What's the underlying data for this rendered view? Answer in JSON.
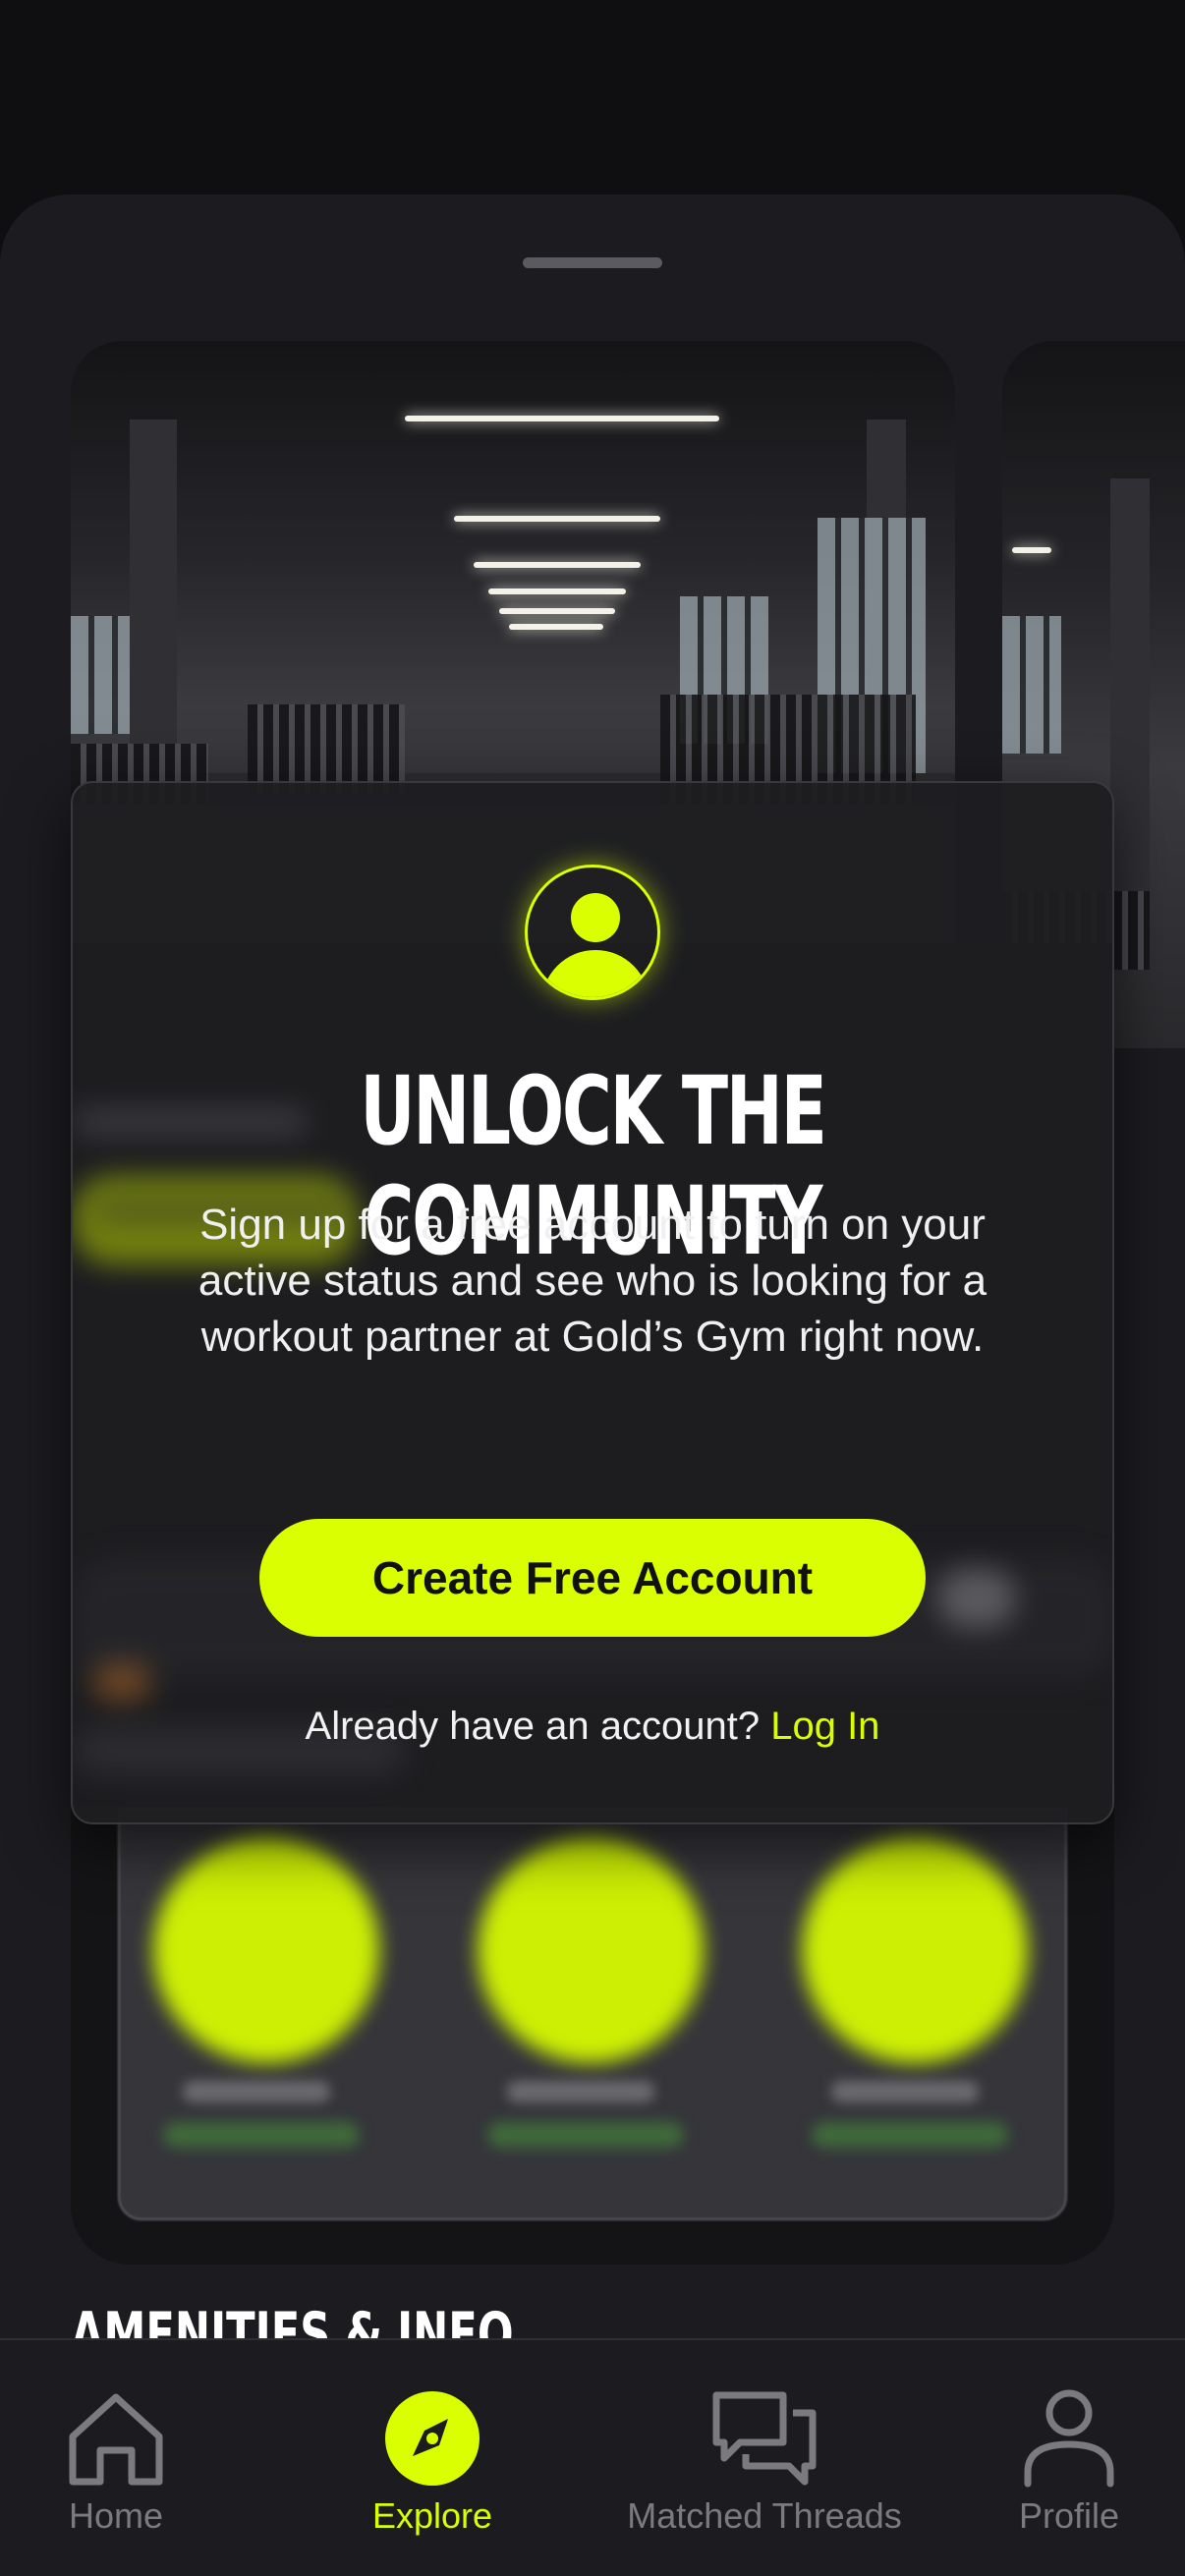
{
  "modal": {
    "title": "UNLOCK THE COMMUNITY",
    "body": "Sign up for a free account to turn on your active status and see who is looking for a workout partner at Gold’s Gym right now.",
    "cta_label": "Create Free Account",
    "login_prompt": "Already have an account?",
    "login_link": "Log In",
    "icon": "user-icon"
  },
  "section_heading": "AMENITIES & INFO",
  "tabs": [
    {
      "label": "Home",
      "icon": "home-icon",
      "active": false
    },
    {
      "label": "Explore",
      "icon": "compass-icon",
      "active": true
    },
    {
      "label": "Matched Threads",
      "icon": "chat-bubbles-icon",
      "active": false
    },
    {
      "label": "Profile",
      "icon": "person-icon",
      "active": false
    }
  ],
  "colors": {
    "accent": "#d9ff00",
    "background": "#0f0f11",
    "sheet": "#1c1c20",
    "muted_text": "#7a7a80"
  }
}
